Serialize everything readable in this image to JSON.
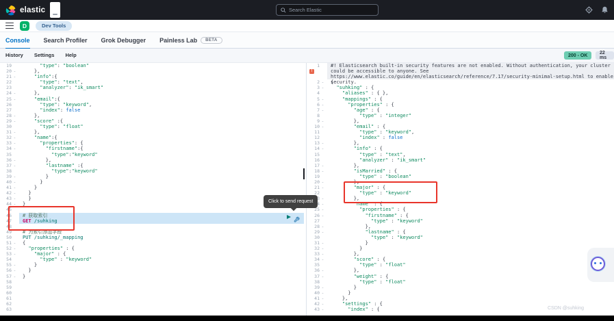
{
  "header": {
    "logo_text": "elastic",
    "search_placeholder": "Search Elastic"
  },
  "breadcrumb_bar": {
    "space_letter": "D",
    "breadcrumb": "Dev Tools"
  },
  "tabs": [
    {
      "label": "Console",
      "active": true
    },
    {
      "label": "Search Profiler",
      "active": false
    },
    {
      "label": "Grok Debugger",
      "active": false
    },
    {
      "label": "Painless Lab",
      "active": false,
      "badge": "BETA"
    }
  ],
  "toolbar": {
    "menu": {
      "history": "History",
      "settings": "Settings",
      "help": "Help"
    },
    "status_badge": "200 - OK",
    "time_badge": "22 ms"
  },
  "request_editor": {
    "highlight_lines": [
      46,
      47
    ],
    "tooltip": "Click to send request",
    "lines": [
      {
        "n": 19,
        "text": "      \"type\": \"boolean\""
      },
      {
        "n": 20,
        "fold": true,
        "text": "    },"
      },
      {
        "n": 21,
        "fold": true,
        "text": "    \"info\":{"
      },
      {
        "n": 22,
        "text": "      \"type\": \"text\","
      },
      {
        "n": 23,
        "text": "      \"analyzer\": \"ik_smart\""
      },
      {
        "n": 24,
        "fold": true,
        "text": "    },"
      },
      {
        "n": 25,
        "fold": true,
        "text": "    \"email\":{"
      },
      {
        "n": 26,
        "text": "      \"type\": \"keyword\","
      },
      {
        "n": 27,
        "text": "      \"index\": false"
      },
      {
        "n": 28,
        "fold": true,
        "text": "    },"
      },
      {
        "n": 29,
        "fold": true,
        "text": "    \"score\" :{"
      },
      {
        "n": 30,
        "text": "      \"type\": \"float\""
      },
      {
        "n": 31,
        "fold": true,
        "text": "    },"
      },
      {
        "n": 32,
        "fold": true,
        "text": "    \"name\":{"
      },
      {
        "n": 33,
        "fold": true,
        "text": "      \"properties\": {"
      },
      {
        "n": 34,
        "fold": true,
        "text": "        \"firstname\":{"
      },
      {
        "n": 35,
        "text": "          \"type\":\"keyword\""
      },
      {
        "n": 36,
        "fold": true,
        "text": "        },"
      },
      {
        "n": 37,
        "fold": true,
        "text": "        \"lastname\" :{"
      },
      {
        "n": 38,
        "text": "          \"type\":\"keyword\""
      },
      {
        "n": 39,
        "fold": true,
        "text": "        }"
      },
      {
        "n": 40,
        "fold": true,
        "text": "      }"
      },
      {
        "n": 41,
        "fold": true,
        "text": "    }"
      },
      {
        "n": 42,
        "fold": true,
        "text": "  }"
      },
      {
        "n": 43,
        "fold": true,
        "text": "  }"
      },
      {
        "n": 44,
        "fold": true,
        "text": "}"
      },
      {
        "n": 45,
        "text": ""
      },
      {
        "n": 46,
        "kind": "comment",
        "text": "# 获取索引"
      },
      {
        "n": 47,
        "kind": "request",
        "text": "GET /suhking"
      },
      {
        "n": 48,
        "text": ""
      },
      {
        "n": 49,
        "kind": "comment",
        "text": "# 为索引添加字段"
      },
      {
        "n": 50,
        "kind": "request",
        "text": "PUT /suhking/_mapping"
      },
      {
        "n": 51,
        "fold": true,
        "text": "{"
      },
      {
        "n": 52,
        "fold": true,
        "text": "  \"properties\" : {"
      },
      {
        "n": 53,
        "fold": true,
        "text": "    \"major\" : {"
      },
      {
        "n": 54,
        "text": "      \"type\" : \"keyword\""
      },
      {
        "n": 55,
        "fold": true,
        "text": "    }"
      },
      {
        "n": 56,
        "fold": true,
        "text": "  }"
      },
      {
        "n": 57,
        "fold": true,
        "text": "}"
      },
      {
        "n": 58,
        "text": ""
      },
      {
        "n": 59,
        "text": ""
      },
      {
        "n": 60,
        "text": ""
      },
      {
        "n": 61,
        "text": ""
      },
      {
        "n": 62,
        "text": ""
      },
      {
        "n": 63,
        "text": ""
      }
    ]
  },
  "response_editor": {
    "lines": [
      {
        "n": 1,
        "kind": "warn",
        "text": "#! Elasticsearch built-in security features are not enabled. Without authentication, your cluster could be accessible to anyone. See https://www.elastic.co/guide/en/elasticsearch/reference/7.17/security-minimal-setup.html to enable security."
      },
      {
        "n": 2,
        "fold": true,
        "text": "{"
      },
      {
        "n": 3,
        "fold": true,
        "text": "  \"suhking\" : {"
      },
      {
        "n": 4,
        "text": "    \"aliases\" : { },"
      },
      {
        "n": 5,
        "fold": true,
        "text": "    \"mappings\" : {"
      },
      {
        "n": 6,
        "fold": true,
        "text": "      \"properties\" : {"
      },
      {
        "n": 7,
        "fold": true,
        "text": "        \"age\" : {"
      },
      {
        "n": 8,
        "text": "          \"type\" : \"integer\""
      },
      {
        "n": 9,
        "fold": true,
        "text": "        },"
      },
      {
        "n": 10,
        "fold": true,
        "text": "        \"email\" : {"
      },
      {
        "n": 11,
        "text": "          \"type\" : \"keyword\","
      },
      {
        "n": 12,
        "text": "          \"index\" : false"
      },
      {
        "n": 13,
        "fold": true,
        "text": "        },"
      },
      {
        "n": 14,
        "fold": true,
        "text": "        \"info\" : {"
      },
      {
        "n": 15,
        "text": "          \"type\" : \"text\","
      },
      {
        "n": 16,
        "text": "          \"analyzer\" : \"ik_smart\""
      },
      {
        "n": 17,
        "fold": true,
        "text": "        },"
      },
      {
        "n": 18,
        "fold": true,
        "text": "        \"isMarried\" : {"
      },
      {
        "n": 19,
        "text": "          \"type\" : \"boolean\""
      },
      {
        "n": 20,
        "fold": true,
        "text": "        },"
      },
      {
        "n": 21,
        "fold": true,
        "text": "        \"major\" : {"
      },
      {
        "n": 22,
        "text": "          \"type\" : \"keyword\""
      },
      {
        "n": 23,
        "fold": true,
        "text": "        },"
      },
      {
        "n": 24,
        "fold": true,
        "text": "        \"name\" : {"
      },
      {
        "n": 25,
        "fold": true,
        "text": "          \"properties\" : {"
      },
      {
        "n": 26,
        "fold": true,
        "text": "            \"firstname\" : {"
      },
      {
        "n": 27,
        "text": "              \"type\" : \"keyword\""
      },
      {
        "n": 28,
        "fold": true,
        "text": "            },"
      },
      {
        "n": 29,
        "fold": true,
        "text": "            \"lastname\" : {"
      },
      {
        "n": 30,
        "text": "              \"type\" : \"keyword\""
      },
      {
        "n": 31,
        "fold": true,
        "text": "            }"
      },
      {
        "n": 32,
        "fold": true,
        "text": "          }"
      },
      {
        "n": 33,
        "fold": true,
        "text": "        },"
      },
      {
        "n": 34,
        "fold": true,
        "text": "        \"score\" : {"
      },
      {
        "n": 35,
        "text": "          \"type\" : \"float\""
      },
      {
        "n": 36,
        "fold": true,
        "text": "        },"
      },
      {
        "n": 37,
        "fold": true,
        "text": "        \"weight\" : {"
      },
      {
        "n": 38,
        "text": "          \"type\" : \"float\""
      },
      {
        "n": 39,
        "fold": true,
        "text": "        }"
      },
      {
        "n": 40,
        "fold": true,
        "text": "      }"
      },
      {
        "n": 41,
        "fold": true,
        "text": "    },"
      },
      {
        "n": 42,
        "fold": true,
        "text": "    \"settings\" : {"
      },
      {
        "n": 43,
        "fold": true,
        "text": "      \"index\" : {"
      }
    ]
  },
  "watermark": "CSDN @suhking",
  "colors": {
    "header_bg": "#1b1d23",
    "accent_blue": "#0072c6",
    "status_ok_bg": "#6dccb1",
    "highlight_row": "#cde5f7",
    "annotation_red": "#e8342a",
    "string_green": "#0e8a5f",
    "method_magenta": "#c80a68",
    "url_teal": "#00756d",
    "const_blue": "#0d6ecb"
  }
}
